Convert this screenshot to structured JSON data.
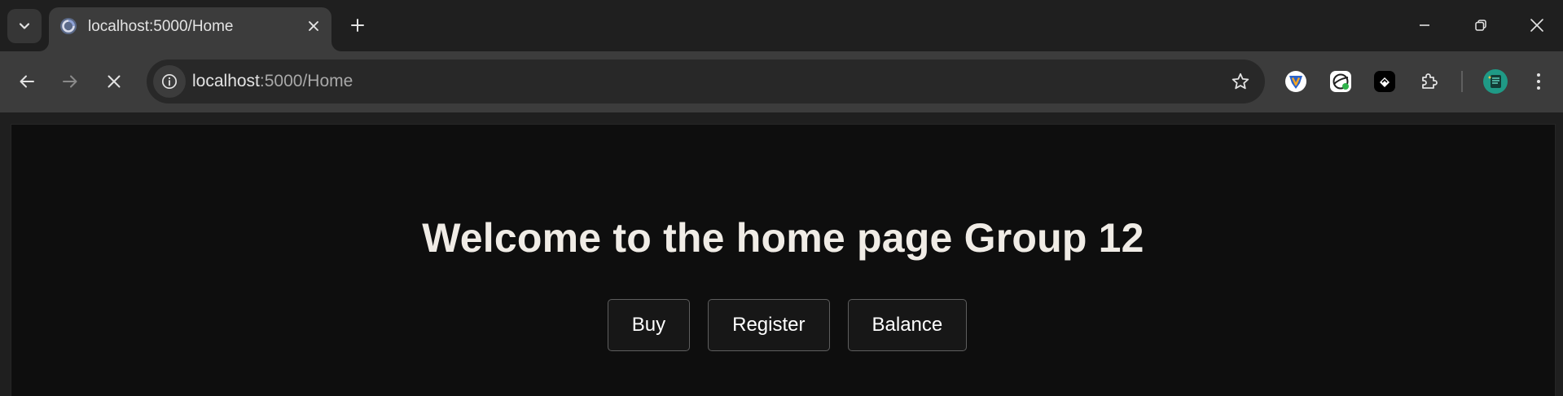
{
  "browser": {
    "tab": {
      "title": "localhost:5000/Home"
    },
    "address_bar": {
      "host": "localhost",
      "path": ":5000/Home"
    },
    "colors": {
      "frame": "#1f1f1f",
      "toolbar": "#3c3c3c",
      "omnibox": "#282828",
      "page_background": "#0e0e0e"
    },
    "icons": {
      "tab_search": "chevron-down-icon",
      "favicon": "loading-globe-icon",
      "tab_close": "close-icon",
      "new_tab": "plus-icon",
      "minimize": "minimize-icon",
      "restore": "restore-icon",
      "close_window": "close-icon",
      "back": "arrow-left-icon",
      "forward": "arrow-right-icon",
      "stop": "stop-loading-icon",
      "site_info": "info-icon",
      "bookmark": "star-icon",
      "extensions": [
        "shield-extension-icon",
        "globe-extension-icon",
        "black-extension-icon",
        "puzzle-icon"
      ],
      "profile": "profile-avatar-icon",
      "menu": "kebab-menu-icon"
    }
  },
  "page": {
    "heading": "Welcome to the home page Group 12",
    "buttons": [
      {
        "label": "Buy"
      },
      {
        "label": "Register"
      },
      {
        "label": "Balance"
      }
    ]
  }
}
